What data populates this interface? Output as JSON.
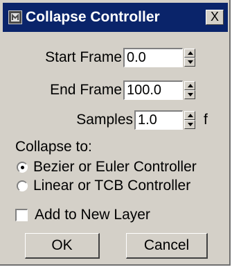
{
  "window": {
    "title": "Collapse Controller",
    "close_label": "X"
  },
  "frames": {
    "start_label": "Start Frame",
    "start_value": "0.0",
    "end_label": "End Frame",
    "end_value": "100.0",
    "samples_label": "Samples",
    "samples_value": "1.0",
    "samples_suffix": "f"
  },
  "collapse": {
    "label": "Collapse to:",
    "options": [
      {
        "label": "Bezier or Euler Controller",
        "selected": true
      },
      {
        "label": "Linear or TCB Controller",
        "selected": false
      }
    ]
  },
  "layer": {
    "label": "Add to New Layer",
    "checked": false
  },
  "buttons": {
    "ok": "OK",
    "cancel": "Cancel"
  },
  "colors": {
    "titlebar": "#0a246a",
    "face": "#d4d0c8"
  },
  "icons": {
    "app": "max-app-icon",
    "close": "close-icon",
    "spinner_up": "arrow-up-icon",
    "spinner_down": "arrow-down-icon"
  }
}
